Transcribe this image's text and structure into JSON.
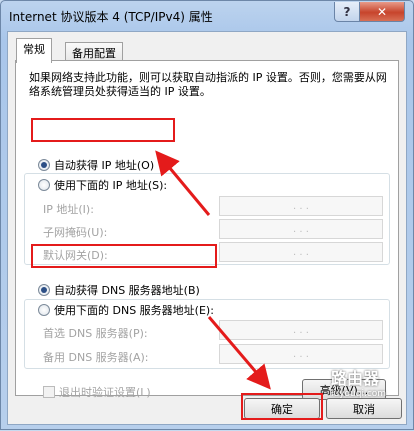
{
  "window": {
    "title": "Internet 协议版本 4 (TCP/IPv4) 属性",
    "help_glyph": "?",
    "close_glyph": "✕"
  },
  "tabs": [
    {
      "label": "常规",
      "active": true
    },
    {
      "label": "备用配置",
      "active": false
    }
  ],
  "description": "如果网络支持此功能，则可以获取自动指派的 IP 设置。否则，您需要从网络系统管理员处获得适当的 IP 设置。",
  "ip_section": {
    "auto_label": "自动获得 IP 地址(O)",
    "manual_label": "使用下面的 IP 地址(S):",
    "fields": [
      {
        "label": "IP 地址(I):"
      },
      {
        "label": "子网掩码(U):"
      },
      {
        "label": "默认网关(D):"
      }
    ]
  },
  "dns_section": {
    "auto_label": "自动获得 DNS 服务器地址(B)",
    "manual_label": "使用下面的 DNS 服务器地址(E):",
    "fields": [
      {
        "label": "首选 DNS 服务器(P):"
      },
      {
        "label": "备用 DNS 服务器(A):"
      }
    ]
  },
  "ip_dots": ".   .   .",
  "validate_label": "退出时验证设置(L)",
  "advanced_label": "高级(V)...",
  "ok_label": "确定",
  "cancel_label": "取消",
  "watermark": {
    "line1": "路由器",
    "line2": "luyouqi.com"
  },
  "colors": {
    "highlight": "#e41b1b",
    "arrow": "#e41b1b"
  }
}
